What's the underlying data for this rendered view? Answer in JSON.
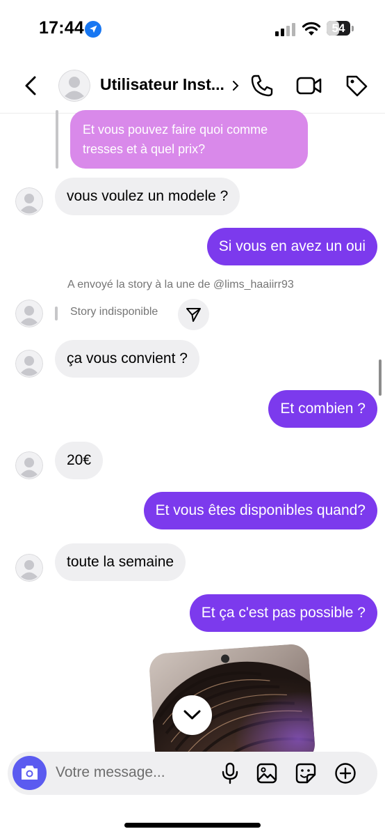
{
  "status_bar": {
    "time": "17:44",
    "battery": "54",
    "battery_level": 0.54
  },
  "header": {
    "username": "Utilisateur Inst..."
  },
  "messages": {
    "reply_quote": "Et vous pouvez faire quoi comme tresses et à quel prix?",
    "m1": "vous voulez un modele ?",
    "m2": "Si vous en avez un oui",
    "story_note": "A envoyé la story à la une de @lims_haaiirr93",
    "story_unavailable": "Story indisponible",
    "m3": "ça vous convient ?",
    "m4": "Et combien ?",
    "m5": "20€",
    "m6": "Et vous êtes disponibles quand?",
    "m7": "toute la semaine",
    "m8": "Et ça c'est pas possible ?"
  },
  "composer": {
    "placeholder": "Votre message..."
  },
  "colors": {
    "outgoing": "#7c3aed",
    "incoming": "#efeff1",
    "quoted": "#d989ea",
    "camera": "#5b5bf0"
  }
}
